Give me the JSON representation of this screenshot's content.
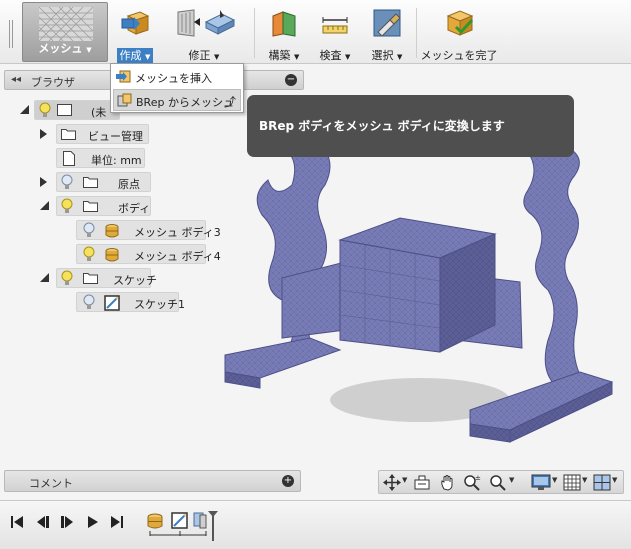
{
  "toolbar": {
    "workspace_label": "メッシュ",
    "items": [
      {
        "label": "作成",
        "icon": "create-icon",
        "active": true
      },
      {
        "label": "修正",
        "icon": "modify-icon"
      },
      {
        "label": "構築",
        "icon": "construct-icon"
      },
      {
        "label": "検査",
        "icon": "inspect-icon"
      },
      {
        "label": "選択",
        "icon": "select-icon"
      },
      {
        "label": "メッシュを完了",
        "icon": "finish-mesh-icon"
      }
    ]
  },
  "browser": {
    "title": "ブラウザ",
    "root_label": "(未",
    "nodes": [
      {
        "label": "ビュー管理"
      },
      {
        "label": "単位: mm"
      },
      {
        "label": "原点"
      },
      {
        "label": "ボディ"
      },
      {
        "label": "メッシュ ボディ3"
      },
      {
        "label": "メッシュ ボディ4"
      },
      {
        "label": "スケッチ"
      },
      {
        "label": "スケッチ1"
      }
    ]
  },
  "create_menu": {
    "items": [
      {
        "label": "メッシュを挿入"
      },
      {
        "label": "BRep からメッシュ"
      }
    ]
  },
  "tooltip": {
    "text": "BRep ボディをメッシュ ボディに変換します"
  },
  "comments": {
    "label": "コメント"
  },
  "colors": {
    "mesh": "#7a7eb8",
    "mesh_dark": "#4d5088",
    "tooltip_bg": "#4f4f4f",
    "accent": "#3c7fc4"
  }
}
